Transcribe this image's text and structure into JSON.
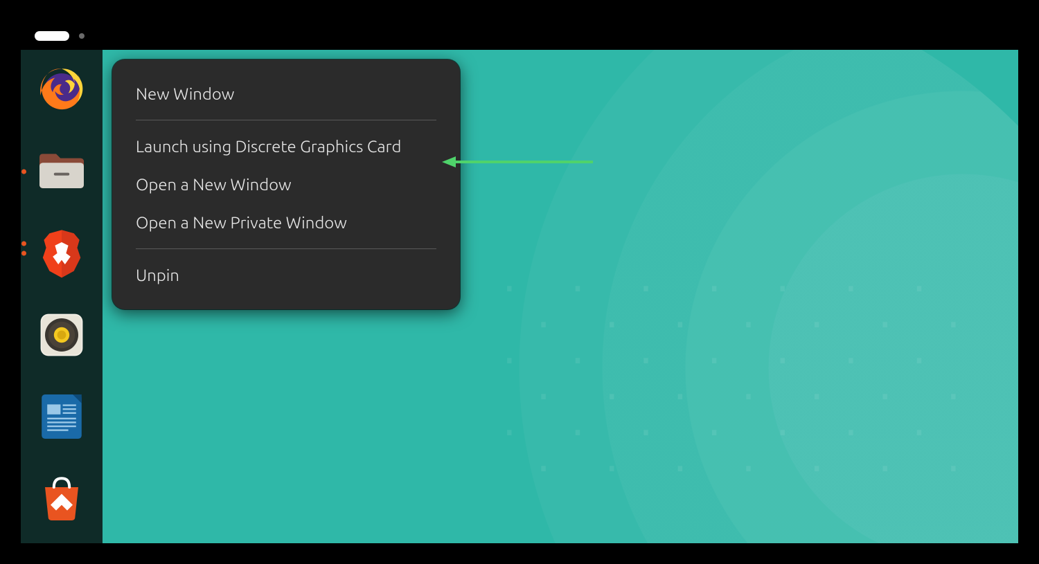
{
  "dock": {
    "items": [
      {
        "name": "firefox",
        "running": false,
        "double_dot": false
      },
      {
        "name": "files",
        "running": true,
        "double_dot": false
      },
      {
        "name": "brave",
        "running": true,
        "double_dot": true
      },
      {
        "name": "rhythmbox",
        "running": false,
        "double_dot": false
      },
      {
        "name": "libreoffice-writer",
        "running": false,
        "double_dot": false
      },
      {
        "name": "ubuntu-software",
        "running": false,
        "double_dot": false
      }
    ]
  },
  "context_menu": {
    "sections": [
      [
        "New Window"
      ],
      [
        "Launch using Discrete Graphics Card",
        "Open a New Window",
        "Open a New Private Window"
      ],
      [
        "Unpin"
      ]
    ]
  },
  "annotation": {
    "target_item_index": 1,
    "color": "#4fd36b"
  },
  "colors": {
    "dock_bg": "#0f2b28",
    "wallpaper": "#2fb8a8",
    "menu_bg": "#2b2b2b",
    "running_dot": "#e95420"
  }
}
